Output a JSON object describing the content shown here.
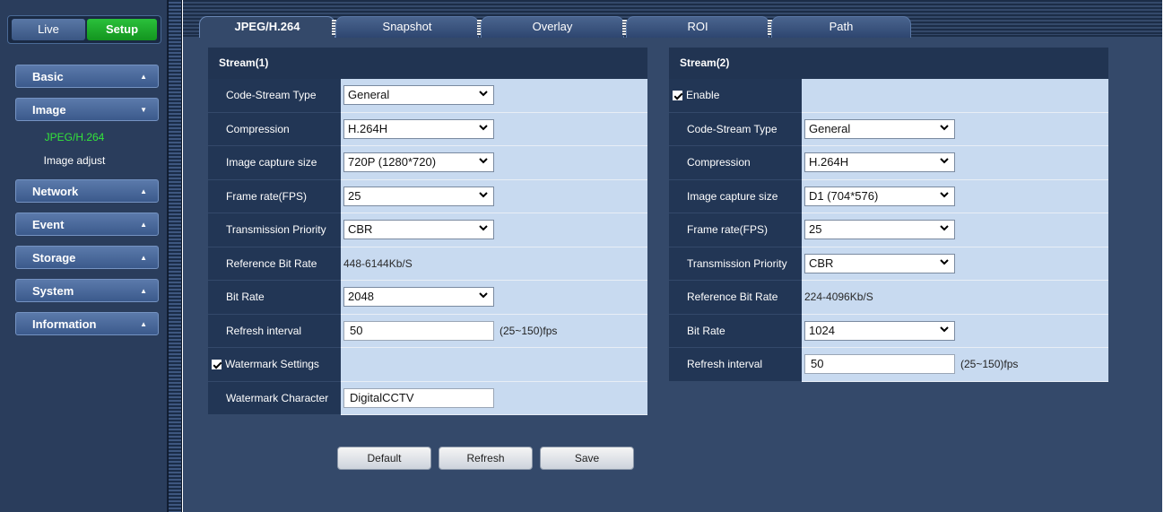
{
  "mode": {
    "live": "Live",
    "setup": "Setup"
  },
  "sidebar": {
    "items": [
      {
        "label": "Basic"
      },
      {
        "label": "Image"
      },
      {
        "label": "Network"
      },
      {
        "label": "Event"
      },
      {
        "label": "Storage"
      },
      {
        "label": "System"
      },
      {
        "label": "Information"
      }
    ],
    "image_sub": [
      "JPEG/H.264",
      "Image adjust"
    ]
  },
  "tabs": [
    "JPEG/H.264",
    "Snapshot",
    "Overlay",
    "ROI",
    "Path"
  ],
  "stream1": {
    "title": "Stream(1)",
    "code_stream_type": {
      "label": "Code-Stream Type",
      "value": "General"
    },
    "compression": {
      "label": "Compression",
      "value": "H.264H"
    },
    "capture_size": {
      "label": "Image capture size",
      "value": "720P (1280*720)"
    },
    "frame_rate": {
      "label": "Frame rate(FPS)",
      "value": "25"
    },
    "priority": {
      "label": "Transmission Priority",
      "value": "CBR"
    },
    "ref_bitrate": {
      "label": "Reference Bit Rate",
      "value": "448-6144Kb/S"
    },
    "bitrate": {
      "label": "Bit Rate",
      "value": "2048"
    },
    "refresh": {
      "label": "Refresh interval",
      "value": "50",
      "hint": "(25~150)fps"
    },
    "watermark": {
      "label": "Watermark Settings",
      "checked": true
    },
    "watermark_char": {
      "label": "Watermark Character",
      "value": "DigitalCCTV"
    }
  },
  "stream2": {
    "title": "Stream(2)",
    "enable": {
      "label": "Enable",
      "checked": true
    },
    "code_stream_type": {
      "label": "Code-Stream Type",
      "value": "General"
    },
    "compression": {
      "label": "Compression",
      "value": "H.264H"
    },
    "capture_size": {
      "label": "Image capture size",
      "value": "D1 (704*576)"
    },
    "frame_rate": {
      "label": "Frame rate(FPS)",
      "value": "25"
    },
    "priority": {
      "label": "Transmission Priority",
      "value": "CBR"
    },
    "ref_bitrate": {
      "label": "Reference Bit Rate",
      "value": "224-4096Kb/S"
    },
    "bitrate": {
      "label": "Bit Rate",
      "value": "1024"
    },
    "refresh": {
      "label": "Refresh interval",
      "value": "50",
      "hint": "(25~150)fps"
    }
  },
  "buttons": {
    "default": "Default",
    "refresh": "Refresh",
    "save": "Save"
  },
  "colors": {
    "accent_active": "#33e53a",
    "setup_green": "#13951f",
    "panel_bg": "#34496a",
    "value_cell": "#c8daf0"
  }
}
